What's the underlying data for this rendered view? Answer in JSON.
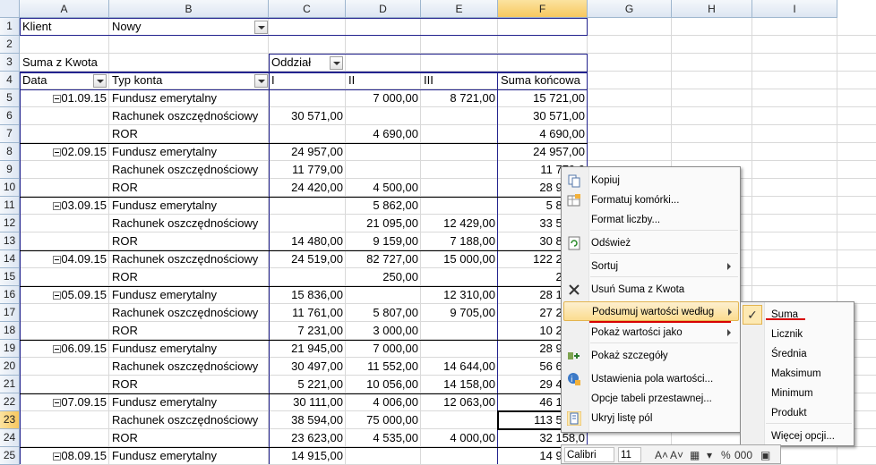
{
  "columns": [
    "A",
    "B",
    "C",
    "D",
    "E",
    "F",
    "G",
    "H",
    "I"
  ],
  "rows": [
    "1",
    "2",
    "3",
    "4",
    "5",
    "6",
    "7",
    "8",
    "9",
    "10",
    "11",
    "12",
    "13",
    "14",
    "15",
    "16",
    "17",
    "18",
    "19",
    "20",
    "21",
    "22",
    "23",
    "24",
    "25"
  ],
  "filter": {
    "label": "Klient",
    "value": "Nowy"
  },
  "pivot": {
    "values_label": "Suma z Kwota",
    "column_field": "Oddział",
    "header_data": "Data",
    "header_type": "Typ konta",
    "header_cols": [
      "I",
      "II",
      "III"
    ],
    "header_total": "Suma końcowa"
  },
  "body": [
    {
      "date": "01.09.15",
      "type": "Fundusz emerytalny",
      "c1": "",
      "c2": "7 000,00",
      "c3": "8 721,00",
      "total": "15 721,00"
    },
    {
      "date": "",
      "type": "Rachunek oszczędnościowy",
      "c1": "30 571,00",
      "c2": "",
      "c3": "",
      "total": "30 571,00"
    },
    {
      "date": "",
      "type": "ROR",
      "c1": "",
      "c2": "4 690,00",
      "c3": "",
      "total": "4 690,00"
    },
    {
      "date": "02.09.15",
      "type": "Fundusz emerytalny",
      "c1": "24 957,00",
      "c2": "",
      "c3": "",
      "total": "24 957,00"
    },
    {
      "date": "",
      "type": "Rachunek oszczędnościowy",
      "c1": "11 779,00",
      "c2": "",
      "c3": "",
      "total": "11 779,0"
    },
    {
      "date": "",
      "type": "ROR",
      "c1": "24 420,00",
      "c2": "4 500,00",
      "c3": "",
      "total": "28 920,0"
    },
    {
      "date": "03.09.15",
      "type": "Fundusz emerytalny",
      "c1": "",
      "c2": "5 862,00",
      "c3": "",
      "total": "5 862,0"
    },
    {
      "date": "",
      "type": "Rachunek oszczędnościowy",
      "c1": "",
      "c2": "21 095,00",
      "c3": "12 429,00",
      "total": "33 524,0"
    },
    {
      "date": "",
      "type": "ROR",
      "c1": "14 480,00",
      "c2": "9 159,00",
      "c3": "7 188,00",
      "total": "30 827,0"
    },
    {
      "date": "04.09.15",
      "type": "Rachunek oszczędnościowy",
      "c1": "24 519,00",
      "c2": "82 727,00",
      "c3": "15 000,00",
      "total": "122 246,0"
    },
    {
      "date": "",
      "type": "ROR",
      "c1": "",
      "c2": "250,00",
      "c3": "",
      "total": "250,0"
    },
    {
      "date": "05.09.15",
      "type": "Fundusz emerytalny",
      "c1": "15 836,00",
      "c2": "",
      "c3": "12 310,00",
      "total": "28 146,0"
    },
    {
      "date": "",
      "type": "Rachunek oszczędnościowy",
      "c1": "11 761,00",
      "c2": "5 807,00",
      "c3": "9 705,00",
      "total": "27 273,0"
    },
    {
      "date": "",
      "type": "ROR",
      "c1": "7 231,00",
      "c2": "3 000,00",
      "c3": "",
      "total": "10 231,0"
    },
    {
      "date": "06.09.15",
      "type": "Fundusz emerytalny",
      "c1": "21 945,00",
      "c2": "7 000,00",
      "c3": "",
      "total": "28 945,0"
    },
    {
      "date": "",
      "type": "Rachunek oszczędnościowy",
      "c1": "30 497,00",
      "c2": "11 552,00",
      "c3": "14 644,00",
      "total": "56 693,0"
    },
    {
      "date": "",
      "type": "ROR",
      "c1": "5 221,00",
      "c2": "10 056,00",
      "c3": "14 158,00",
      "total": "29 435,0"
    },
    {
      "date": "07.09.15",
      "type": "Fundusz emerytalny",
      "c1": "30 111,00",
      "c2": "4 006,00",
      "c3": "12 063,00",
      "total": "46 180,0"
    },
    {
      "date": "",
      "type": "Rachunek oszczędnościowy",
      "c1": "38 594,00",
      "c2": "75 000,00",
      "c3": "",
      "total": "113 594,0"
    },
    {
      "date": "",
      "type": "ROR",
      "c1": "23 623,00",
      "c2": "4 535,00",
      "c3": "4 000,00",
      "total": "32 158,0"
    },
    {
      "date": "08.09.15",
      "type": "Fundusz emerytalny",
      "c1": "14 915,00",
      "c2": "",
      "c3": "",
      "total": "14 915,0"
    }
  ],
  "context_menu": {
    "items": [
      {
        "label": "Kopiuj",
        "icon": "copy-icon"
      },
      {
        "label": "Formatuj komórki...",
        "icon": "format-cells-icon"
      },
      {
        "label": "Format liczby...",
        "icon": ""
      },
      {
        "label": "Odśwież",
        "icon": "refresh-icon"
      },
      {
        "label": "Sortuj",
        "icon": "",
        "submenu": true
      },
      {
        "label": "Usuń Suma z Kwota",
        "icon": "delete-x-icon"
      },
      {
        "label": "Podsumuj wartości według",
        "icon": "",
        "submenu": true,
        "highlighted": true
      },
      {
        "label": "Pokaż wartości jako",
        "icon": "",
        "submenu": true
      },
      {
        "label": "Pokaż szczegóły",
        "icon": "show-details-icon"
      },
      {
        "label": "Ustawienia pola wartości...",
        "icon": "field-settings-icon"
      },
      {
        "label": "Opcje tabeli przestawnej...",
        "icon": ""
      },
      {
        "label": "Ukryj listę pól",
        "icon": "field-list-icon"
      }
    ]
  },
  "submenu": {
    "items": [
      {
        "label": "Suma",
        "checked": true
      },
      {
        "label": "Licznik"
      },
      {
        "label": "Średnia"
      },
      {
        "label": "Maksimum"
      },
      {
        "label": "Minimum"
      },
      {
        "label": "Produkt"
      },
      {
        "label": "Więcej opcji..."
      }
    ]
  },
  "mini_toolbar": {
    "font": "Calibri",
    "size": "11",
    "percent": "%",
    "thousands": "000"
  },
  "colors": {
    "pivot_border": "#23238e",
    "menu_highlight": "#fbdc8f",
    "underline_red": "#d80000",
    "selected_header": "#f7c85f"
  }
}
